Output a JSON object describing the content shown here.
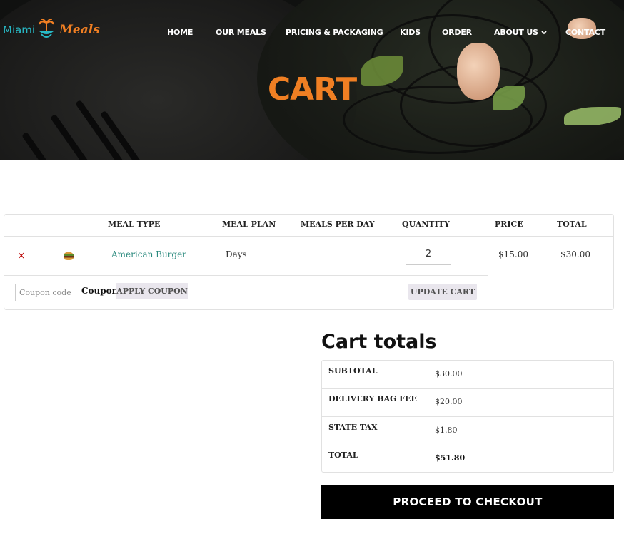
{
  "brand": {
    "part1": "Miami",
    "part2": "Meals"
  },
  "nav": {
    "home": "HOME",
    "our_meals": "OUR MEALS",
    "pricing": "PRICING & PACKAGING",
    "kids": "KIDS",
    "order": "ORDER",
    "about": "ABOUT US",
    "contact": "CONTACT"
  },
  "page_title": "CART",
  "cart": {
    "headers": {
      "meal_type": "MEAL TYPE",
      "meal_plan": "MEAL PLAN",
      "meals_per_day": "MEALS PER DAY",
      "quantity": "QUANTITY",
      "price": "PRICE",
      "total": "TOTAL"
    },
    "items": [
      {
        "remove": "×",
        "product": "American Burger",
        "meal_plan": "Days",
        "meals_per_day": "",
        "quantity": "2",
        "price": "$15.00",
        "total": "$30.00"
      }
    ],
    "coupon_placeholder": "Coupon code",
    "coupon_label": "Coupon:",
    "apply_coupon": "APPLY COUPON",
    "update_cart": "UPDATE CART"
  },
  "totals": {
    "title": "Cart totals",
    "rows": [
      {
        "label": "SUBTOTAL",
        "value": "$30.00"
      },
      {
        "label": "DELIVERY BAG FEE",
        "value": "$20.00"
      },
      {
        "label": "STATE TAX",
        "value": "$1.80"
      },
      {
        "label": "TOTAL",
        "value": "$51.80"
      }
    ],
    "checkout": "PROCEED TO CHECKOUT"
  },
  "colors": {
    "accent_orange": "#f07f23",
    "accent_teal": "#28b9c5",
    "link_teal": "#2b8a7e",
    "remove_red": "#bb0000"
  },
  "icons": {
    "remove": "close-icon",
    "product_thumb": "burger-icon",
    "about_dropdown": "chevron-down-icon"
  }
}
